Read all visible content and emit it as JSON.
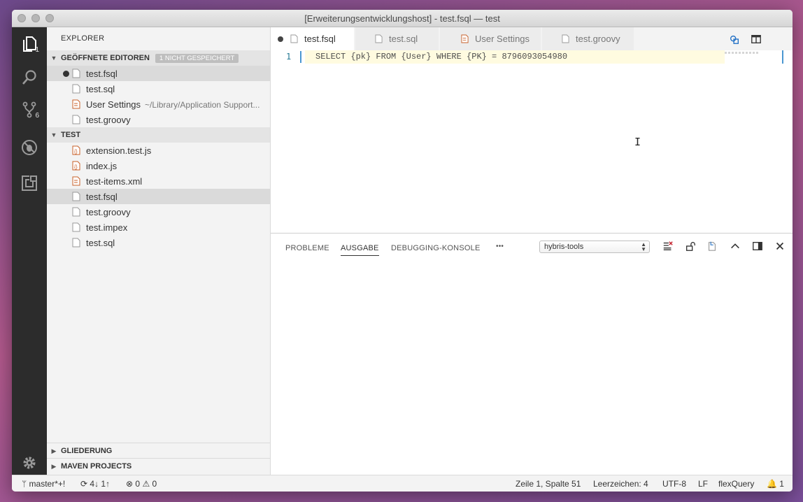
{
  "window": {
    "title": "[Erweiterungsentwicklungshost] - test.fsql — test"
  },
  "activity": {
    "explorer_badge": "1",
    "scm_badge": "6"
  },
  "sidebar": {
    "title": "EXPLORER",
    "open_editors": {
      "header": "GEÖFFNETE EDITOREN",
      "badge": "1 NICHT GESPEICHERT",
      "items": [
        {
          "name": "test.fsql",
          "desc": ""
        },
        {
          "name": "test.sql",
          "desc": ""
        },
        {
          "name": "User Settings",
          "desc": "~/Library/Application Support..."
        },
        {
          "name": "test.groovy",
          "desc": ""
        }
      ]
    },
    "folder": {
      "header": "TEST",
      "items": [
        {
          "name": "extension.test.js"
        },
        {
          "name": "index.js"
        },
        {
          "name": "test-items.xml"
        },
        {
          "name": "test.fsql"
        },
        {
          "name": "test.groovy"
        },
        {
          "name": "test.impex"
        },
        {
          "name": "test.sql"
        }
      ]
    },
    "outline": "GLIEDERUNG",
    "maven": "MAVEN PROJECTS"
  },
  "tabs": [
    {
      "label": "test.fsql"
    },
    {
      "label": "test.sql"
    },
    {
      "label": "User Settings"
    },
    {
      "label": "test.groovy"
    }
  ],
  "editor": {
    "line_number": "1",
    "code": "SELECT {pk} FROM {User} WHERE {PK} = 8796093054980"
  },
  "panel": {
    "tabs": [
      "PROBLEME",
      "AUSGABE",
      "DEBUGGING-KONSOLE"
    ],
    "more": "•••",
    "select_value": "hybris-tools"
  },
  "status": {
    "branch": "master*+!",
    "sync": "4↓ 1↑",
    "errors": "0",
    "warnings": "0",
    "position": "Zeile 1, Spalte 51",
    "spaces": "Leerzeichen: 4",
    "encoding": "UTF-8",
    "eol": "LF",
    "language": "flexQuery",
    "notifications": "1"
  },
  "colors": {
    "activity_bar": "#2c2c2c",
    "sidebar": "#f3f3f3",
    "line_number": "#237893",
    "cursor": "#4b97d1"
  }
}
